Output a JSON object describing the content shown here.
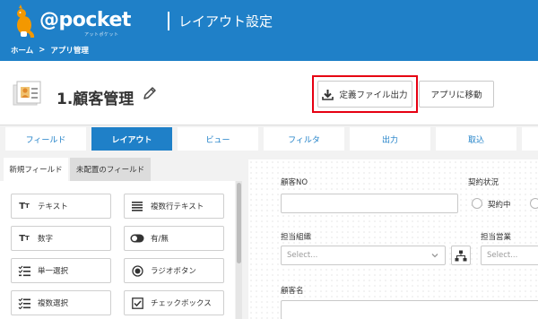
{
  "header": {
    "logo_text": "@pocket",
    "logo_sub": "アットポケット",
    "title": "レイアウト設定",
    "breadcrumb": [
      "ホーム",
      ">",
      "アプリ管理"
    ],
    "color": "#1f80c8"
  },
  "titlebar": {
    "title": "1.顧客管理",
    "export_button": "定義ファイル出力",
    "move_button": "アプリに移動",
    "highlight_color": "#e60012"
  },
  "tabs": [
    "フィールド",
    "レイアウト",
    "ビュー",
    "フィルタ",
    "出力",
    "取込"
  ],
  "active_tab": "レイアウト",
  "palette": {
    "subtabs": [
      "新規フィールド",
      "未配置のフィールド"
    ],
    "items": [
      {
        "label": "テキスト",
        "icon": "text-icon"
      },
      {
        "label": "複数行テキスト",
        "icon": "multiline-icon"
      },
      {
        "label": "数字",
        "icon": "number-icon"
      },
      {
        "label": "有/無",
        "icon": "toggle-icon"
      },
      {
        "label": "単一選択",
        "icon": "single-select-icon"
      },
      {
        "label": "ラジオボタン",
        "icon": "radio-icon"
      },
      {
        "label": "複数選択",
        "icon": "multi-select-icon"
      },
      {
        "label": "チェックボックス",
        "icon": "checkbox-icon"
      }
    ]
  },
  "form": {
    "customer_no_label": "顧客NO",
    "contract_label": "契約状況",
    "contract_option": "契約中",
    "org_label": "担当組織",
    "org_placeholder": "Select...",
    "sales_label": "担当営業",
    "sales_placeholder": "Select...",
    "customer_name_label": "顧客名"
  }
}
